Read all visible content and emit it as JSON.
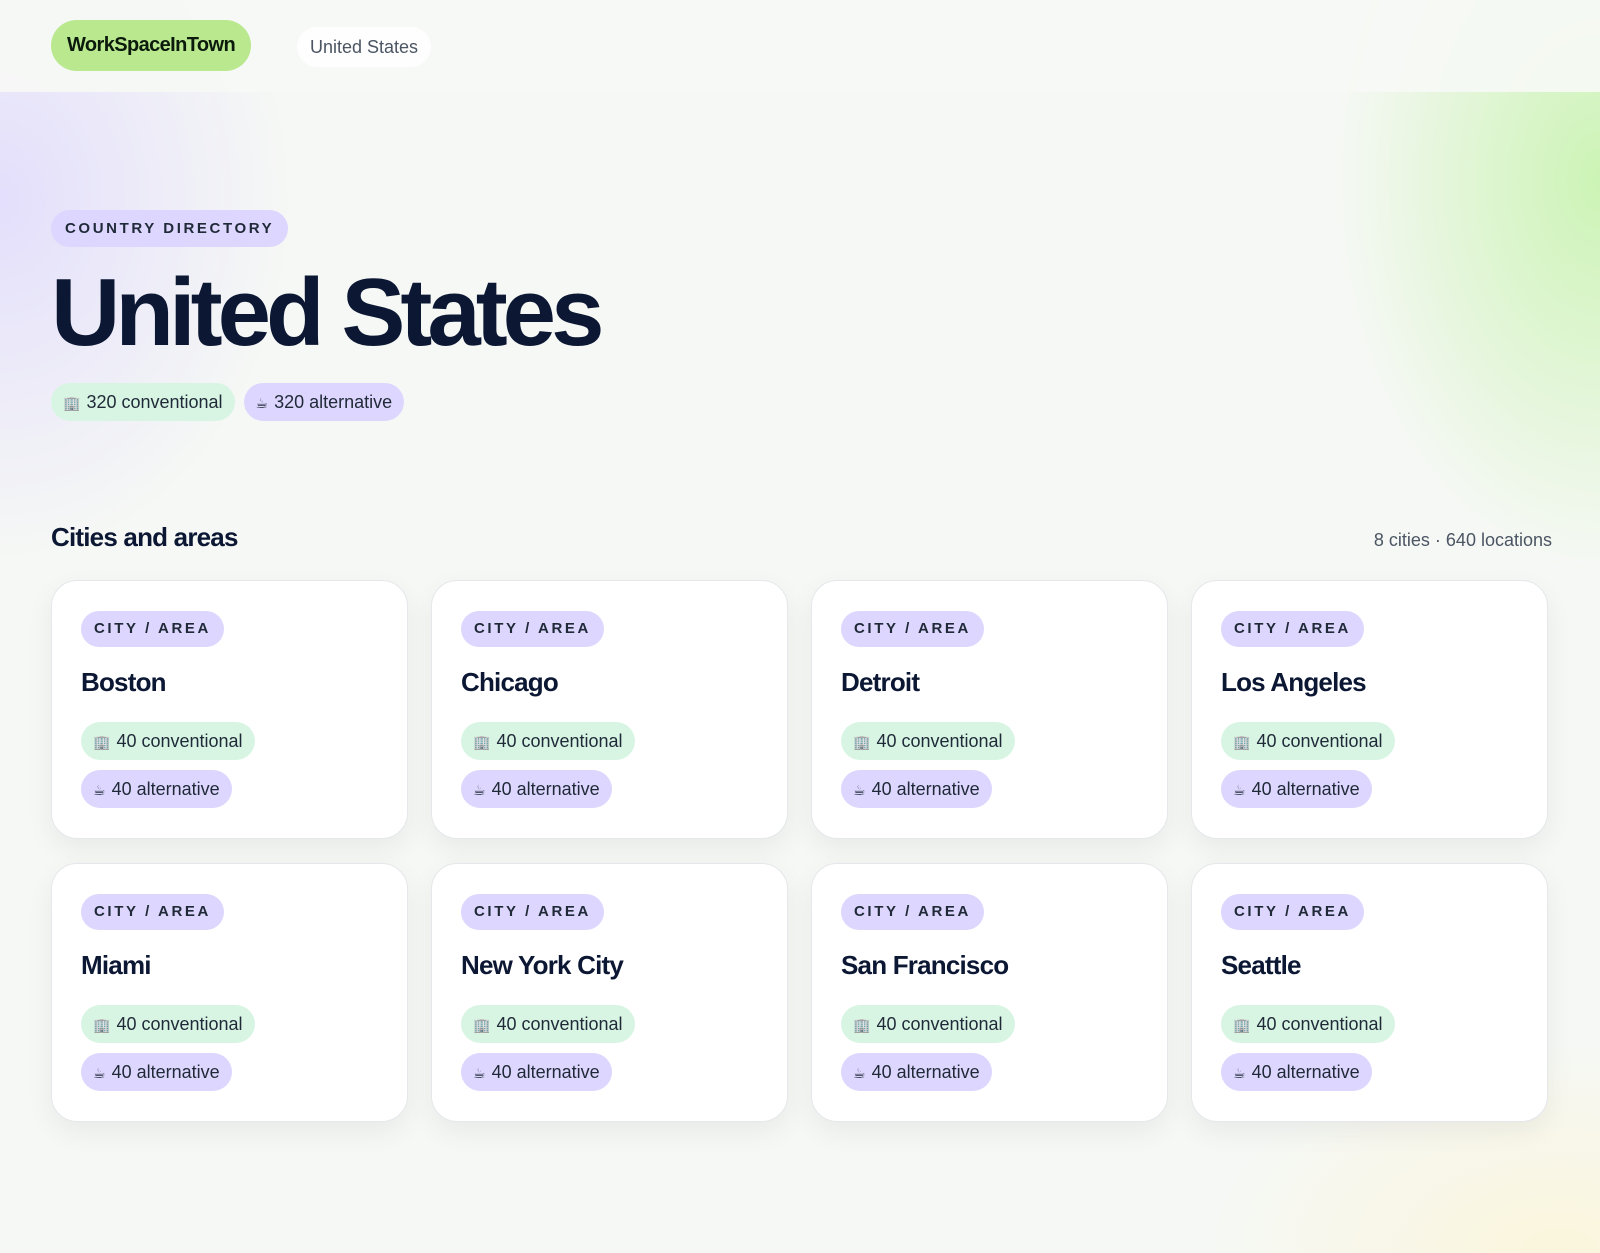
{
  "header": {
    "logo": "WorkSpaceInTown",
    "breadcrumb": "United States"
  },
  "hero": {
    "eyebrow": "COUNTRY DIRECTORY",
    "title": "United States",
    "conventional_icon": "🏢",
    "conventional_label": "320 conventional",
    "alternative_icon": "☕",
    "alternative_label": "320 alternative"
  },
  "section": {
    "title": "Cities and areas",
    "meta": "8 cities · 640 locations"
  },
  "cities": [
    {
      "tag": "CITY / AREA",
      "name": "Boston",
      "conv_icon": "🏢",
      "conventional": "40 conventional",
      "alt_icon": "☕",
      "alternative": "40 alternative"
    },
    {
      "tag": "CITY / AREA",
      "name": "Chicago",
      "conv_icon": "🏢",
      "conventional": "40 conventional",
      "alt_icon": "☕",
      "alternative": "40 alternative"
    },
    {
      "tag": "CITY / AREA",
      "name": "Detroit",
      "conv_icon": "🏢",
      "conventional": "40 conventional",
      "alt_icon": "☕",
      "alternative": "40 alternative"
    },
    {
      "tag": "CITY / AREA",
      "name": "Los Angeles",
      "conv_icon": "🏢",
      "conventional": "40 conventional",
      "alt_icon": "☕",
      "alternative": "40 alternative"
    },
    {
      "tag": "CITY / AREA",
      "name": "Miami",
      "conv_icon": "🏢",
      "conventional": "40 conventional",
      "alt_icon": "☕",
      "alternative": "40 alternative"
    },
    {
      "tag": "CITY / AREA",
      "name": "New York City",
      "conv_icon": "🏢",
      "conventional": "40 conventional",
      "alt_icon": "☕",
      "alternative": "40 alternative"
    },
    {
      "tag": "CITY / AREA",
      "name": "San Francisco",
      "conv_icon": "🏢",
      "conventional": "40 conventional",
      "alt_icon": "☕",
      "alternative": "40 alternative"
    },
    {
      "tag": "CITY / AREA",
      "name": "Seattle",
      "conv_icon": "🏢",
      "conventional": "40 conventional",
      "alt_icon": "☕",
      "alternative": "40 alternative"
    }
  ],
  "colors": {
    "logo_bg": "#b9e88f",
    "lavender": "#ddd6fe",
    "mint": "#d8f5e4",
    "title": "#0b1733"
  }
}
